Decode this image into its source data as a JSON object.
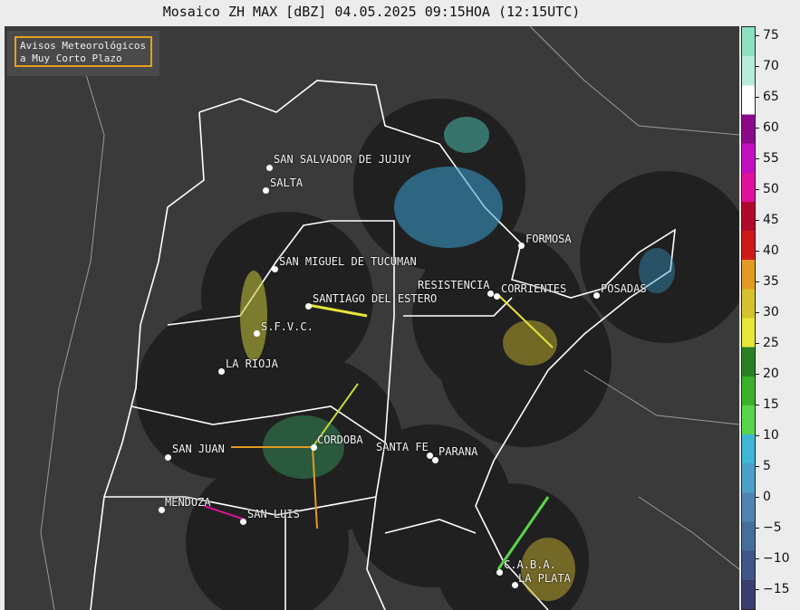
{
  "title": "Mosaico ZH MAX [dBZ] 04.05.2025 09:15HOA (12:15UTC)",
  "alert_box": {
    "line1": "Avisos Meteorológicos",
    "line2": "a Muy Corto Plazo",
    "border_color": "#e3a021"
  },
  "cities": [
    {
      "name": "SAN SALVADOR DE JUJUY"
    },
    {
      "name": "SALTA"
    },
    {
      "name": "FORMOSA"
    },
    {
      "name": "SAN MIGUEL DE TUCUMAN"
    },
    {
      "name": "RESISTENCIA"
    },
    {
      "name": "CORRIENTES"
    },
    {
      "name": "POSADAS"
    },
    {
      "name": "SANTIAGO DEL ESTERO"
    },
    {
      "name": "S.F.V.C."
    },
    {
      "name": "LA RIOJA"
    },
    {
      "name": "CORDOBA"
    },
    {
      "name": "SANTA FE"
    },
    {
      "name": "PARANA"
    },
    {
      "name": "SAN JUAN"
    },
    {
      "name": "MENDOZA"
    },
    {
      "name": "SAN LUIS"
    },
    {
      "name": "C.A.B.A."
    },
    {
      "name": "LA PLATA"
    }
  ],
  "colorbar": {
    "unit": "dBZ",
    "ticks": [
      "75",
      "70",
      "65",
      "60",
      "55",
      "50",
      "45",
      "40",
      "35",
      "30",
      "25",
      "20",
      "15",
      "10",
      "5",
      "0",
      "−5",
      "−10",
      "−15"
    ],
    "colors": [
      "#3a3f6e",
      "#3e5585",
      "#466e9c",
      "#4f84b0",
      "#4fa0c8",
      "#3fb6d6",
      "#5ad44a",
      "#3bb02a",
      "#2a7f22",
      "#e6e63a",
      "#d4c22e",
      "#e39a22",
      "#d01a1a",
      "#b00a2a",
      "#e0109a",
      "#c010c0",
      "#8a0a8a",
      "#ffffff",
      "#b8ecd8",
      "#8ee0c0"
    ]
  }
}
